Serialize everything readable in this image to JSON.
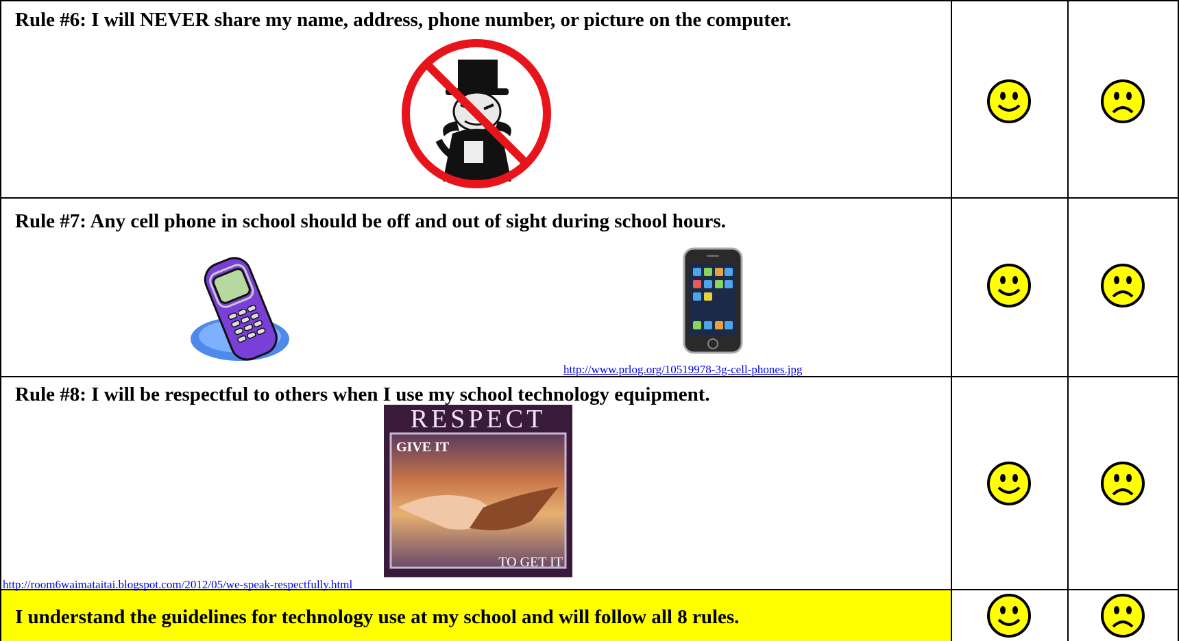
{
  "rules": [
    {
      "text": "Rule #6: I will NEVER share my name, address, phone number, or picture on the computer."
    },
    {
      "text": "Rule #7: Any cell phone in school should be off and out of sight during school hours.",
      "link": "http://www.prlog.org/10519978-3g-cell-phones.jpg"
    },
    {
      "text": "Rule #8: I will be respectful to others when I use my school technology equipment.",
      "link": "http://room6waimataitai.blogspot.com/2012/05/we-speak-respectfully.html"
    }
  ],
  "respect_poster": {
    "title": "RESPECT",
    "top_line": "GIVE IT",
    "bottom_line": "TO GET IT"
  },
  "final_statement": "I understand the guidelines for technology use at my school and will follow all 8 rules.",
  "colors": {
    "highlight": "#ffff00",
    "face": "#ffff00",
    "no_symbol": "#e8141b",
    "link": "#0000ee",
    "phone_purple": "#7a3fd8"
  },
  "icons": [
    "no-stranger-icon",
    "flip-cell-phone-icon",
    "smartphone-icon",
    "respect-poster-image",
    "smiley-face-icon",
    "frowny-face-icon"
  ]
}
